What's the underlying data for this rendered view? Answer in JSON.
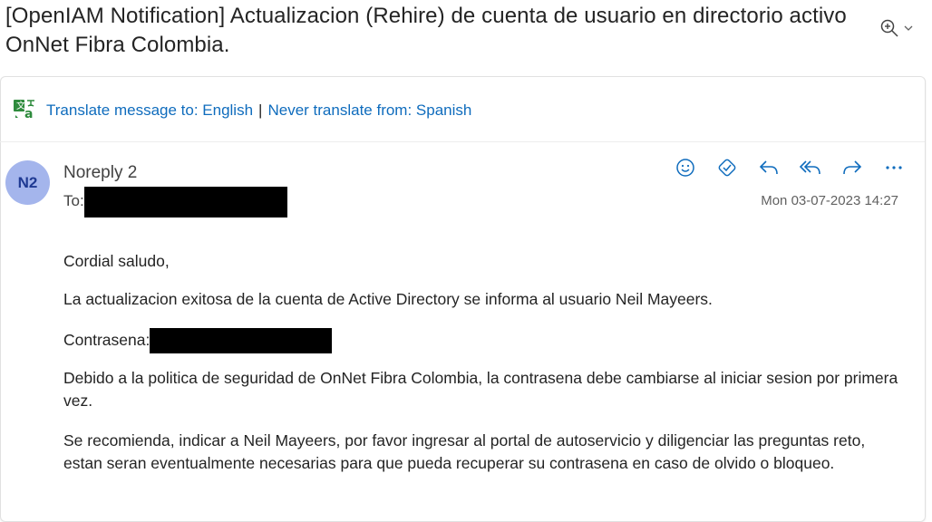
{
  "email": {
    "subject": "[OpenIAM Notification] Actualizacion (Rehire) de cuenta de usuario en directorio activo OnNet Fibra Colombia.",
    "translate": {
      "translate_link": "Translate message to: English",
      "separator": "|",
      "never_link": "Never translate from: Spanish"
    },
    "sender": {
      "initials": "N2",
      "name": "Noreply 2",
      "to_label": "To:",
      "date": "Mon 03-07-2023 14:27"
    },
    "actions": [
      {
        "icon": "emoji-icon"
      },
      {
        "icon": "sticker-icon"
      },
      {
        "icon": "reply-icon"
      },
      {
        "icon": "reply-all-icon"
      },
      {
        "icon": "forward-icon"
      },
      {
        "icon": "more-icon"
      }
    ],
    "body": {
      "greeting": "Cordial saludo,",
      "line1": "La actualizacion exitosa de la cuenta de Active Directory se informa al usuario Neil Mayeers.",
      "password_label": "Contrasena:",
      "line2": "Debido a la politica de seguridad de OnNet Fibra Colombia, la contrasena debe cambiarse al iniciar sesion por primera vez.",
      "line3": "Se recomienda, indicar a Neil Mayeers, por favor ingresar al portal de autoservicio y diligenciar las preguntas reto, estan seran eventualmente necesarias para que pueda recuperar su contrasena en caso de olvido o bloqueo."
    }
  },
  "colors": {
    "link": "#0f6cbd",
    "avatar_bg": "#a4b5ec",
    "avatar_text": "#1f3a93",
    "icon": "#0f6cbd"
  }
}
